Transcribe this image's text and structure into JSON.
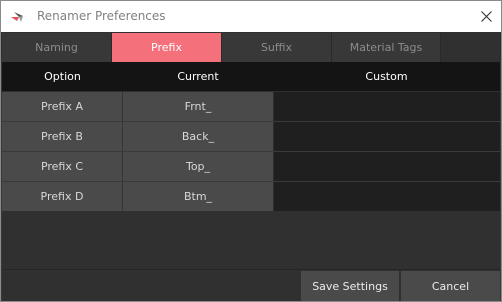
{
  "window": {
    "title": "Renamer Preferences",
    "app_icon": "renamer-app-icon",
    "close_icon": "close-icon"
  },
  "tabs": [
    {
      "label": "Naming",
      "active": false
    },
    {
      "label": "Prefix",
      "active": true
    },
    {
      "label": "Suffix",
      "active": false
    },
    {
      "label": "Material Tags",
      "active": false
    }
  ],
  "table": {
    "headers": [
      "Option",
      "Current",
      "Custom"
    ],
    "rows": [
      {
        "option": "Prefix A",
        "current": "Frnt_",
        "custom": ""
      },
      {
        "option": "Prefix B",
        "current": "Back_",
        "custom": ""
      },
      {
        "option": "Prefix C",
        "current": "Top_",
        "custom": ""
      },
      {
        "option": "Prefix D",
        "current": "Btm_",
        "custom": ""
      }
    ]
  },
  "footer": {
    "save_label": "Save Settings",
    "cancel_label": "Cancel"
  },
  "colors": {
    "accent": "#f4707a",
    "background": "#3a3a3a",
    "header_bg": "#141414",
    "cell_bg": "#4a4a4a",
    "input_bg": "#1f1f1f"
  }
}
